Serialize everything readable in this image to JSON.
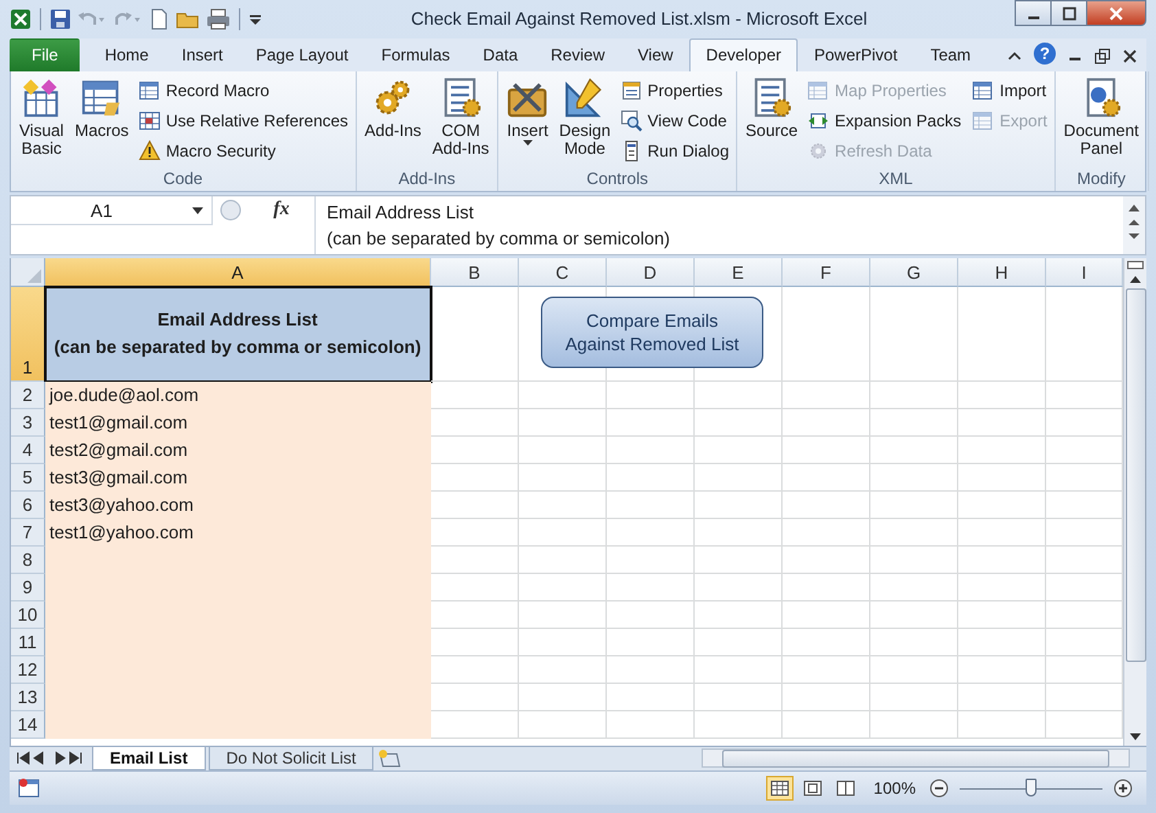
{
  "window": {
    "title": "Check Email Against Removed List.xlsm  -  Microsoft Excel"
  },
  "tabs": [
    {
      "label": "File",
      "kind": "file",
      "selected": false
    },
    {
      "label": "Home",
      "kind": "tab",
      "selected": false
    },
    {
      "label": "Insert",
      "kind": "tab",
      "selected": false
    },
    {
      "label": "Page Layout",
      "kind": "tab",
      "selected": false
    },
    {
      "label": "Formulas",
      "kind": "tab",
      "selected": false
    },
    {
      "label": "Data",
      "kind": "tab",
      "selected": false
    },
    {
      "label": "Review",
      "kind": "tab",
      "selected": false
    },
    {
      "label": "View",
      "kind": "tab",
      "selected": false
    },
    {
      "label": "Developer",
      "kind": "tab",
      "selected": true
    },
    {
      "label": "PowerPivot",
      "kind": "tab",
      "selected": false
    },
    {
      "label": "Team",
      "kind": "tab",
      "selected": false
    }
  ],
  "help": "?",
  "ribbon": {
    "groups": [
      {
        "label": "Code",
        "items": [
          {
            "kind": "large",
            "lines": [
              "Visual",
              "Basic"
            ],
            "disabled": false
          },
          {
            "kind": "large",
            "lines": [
              "Macros"
            ],
            "disabled": false
          },
          {
            "kind": "small",
            "lines": [
              "Record Macro"
            ],
            "disabled": false
          },
          {
            "kind": "small",
            "lines": [
              "Use Relative References"
            ],
            "disabled": false
          },
          {
            "kind": "small",
            "lines": [
              "Macro Security"
            ],
            "disabled": false
          }
        ]
      },
      {
        "label": "Add-Ins",
        "items": [
          {
            "kind": "large",
            "lines": [
              "Add-Ins"
            ],
            "disabled": false
          },
          {
            "kind": "large",
            "lines": [
              "COM",
              "Add-Ins"
            ],
            "disabled": false
          }
        ]
      },
      {
        "label": "Controls",
        "items": [
          {
            "kind": "dropdown",
            "lines": [
              "Insert"
            ],
            "disabled": false
          },
          {
            "kind": "large",
            "lines": [
              "Design",
              "Mode"
            ],
            "disabled": false
          },
          {
            "kind": "small",
            "lines": [
              "Properties"
            ],
            "disabled": false
          },
          {
            "kind": "small",
            "lines": [
              "View Code"
            ],
            "disabled": false
          },
          {
            "kind": "small",
            "lines": [
              "Run Dialog"
            ],
            "disabled": false
          }
        ]
      },
      {
        "label": "XML",
        "items": [
          {
            "kind": "large",
            "lines": [
              "Source"
            ],
            "disabled": false
          },
          {
            "kind": "small",
            "lines": [
              "Map Properties"
            ],
            "disabled": true
          },
          {
            "kind": "small",
            "lines": [
              "Expansion Packs"
            ],
            "disabled": false
          },
          {
            "kind": "small",
            "lines": [
              "Refresh Data"
            ],
            "disabled": true
          },
          {
            "kind": "small",
            "lines": [
              "Import"
            ],
            "disabled": false
          },
          {
            "kind": "small",
            "lines": [
              "Export"
            ],
            "disabled": true
          }
        ]
      },
      {
        "label": "Modify",
        "items": [
          {
            "kind": "large",
            "lines": [
              "Document",
              "Panel"
            ],
            "disabled": false
          }
        ]
      }
    ]
  },
  "formula_bar": {
    "name_box": "A1",
    "function_label": "fx",
    "formula": "Email Address List\n(can be separated by comma or semicolon)"
  },
  "sheet": {
    "columns": [
      {
        "label": "A",
        "selected": true
      },
      {
        "label": "B",
        "selected": false
      },
      {
        "label": "C",
        "selected": false
      },
      {
        "label": "D",
        "selected": false
      },
      {
        "label": "E",
        "selected": false
      },
      {
        "label": "F",
        "selected": false
      },
      {
        "label": "G",
        "selected": false
      },
      {
        "label": "H",
        "selected": false
      },
      {
        "label": "I",
        "selected": false
      }
    ],
    "rows": [
      {
        "label": "1",
        "selected": true,
        "kind": "header",
        "value": "Email Address List\n(can be separated by comma or semicolon)"
      },
      {
        "label": "2",
        "selected": false,
        "kind": "data",
        "value": "joe.dude@aol.com"
      },
      {
        "label": "3",
        "selected": false,
        "kind": "data",
        "value": "test1@gmail.com"
      },
      {
        "label": "4",
        "selected": false,
        "kind": "data",
        "value": "test2@gmail.com"
      },
      {
        "label": "5",
        "selected": false,
        "kind": "data",
        "value": "test3@gmail.com"
      },
      {
        "label": "6",
        "selected": false,
        "kind": "data",
        "value": "test3@yahoo.com"
      },
      {
        "label": "7",
        "selected": false,
        "kind": "data",
        "value": "test1@yahoo.com"
      },
      {
        "label": "8",
        "selected": false,
        "kind": "data"
      },
      {
        "label": "9",
        "selected": false,
        "kind": "data"
      },
      {
        "label": "10",
        "selected": false,
        "kind": "data"
      },
      {
        "label": "11",
        "selected": false,
        "kind": "data"
      },
      {
        "label": "12",
        "selected": false,
        "kind": "data"
      },
      {
        "label": "13",
        "selected": false,
        "kind": "data"
      },
      {
        "label": "14",
        "selected": false,
        "kind": "data"
      }
    ],
    "shape": {
      "label": "Compare Emails\nAgainst Removed List"
    }
  },
  "sheet_tabs": [
    {
      "label": "Email List",
      "selected": true
    },
    {
      "label": "Do Not Solicit List",
      "selected": false
    }
  ],
  "status_bar": {
    "views": [
      {
        "selected": true
      },
      {
        "selected": false
      },
      {
        "selected": false
      }
    ],
    "zoom": "100%",
    "zoom_slider": {
      "level": 0.5
    }
  }
}
